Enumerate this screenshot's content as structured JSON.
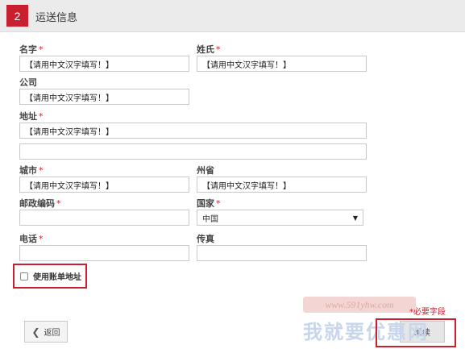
{
  "header": {
    "step": "2",
    "title": "运送信息"
  },
  "form": {
    "first_name": {
      "label": "名字",
      "value": "【请用中文汉字填写！】"
    },
    "last_name": {
      "label": "姓氏",
      "value": "【请用中文汉字填写！】"
    },
    "company": {
      "label": "公司",
      "value": "【请用中文汉字填写！】"
    },
    "address": {
      "label": "地址",
      "value": "【请用中文汉字填写！】",
      "value2": ""
    },
    "city": {
      "label": "城市",
      "value": "【请用中文汉字填写！】"
    },
    "state": {
      "label": "州省",
      "value": "【请用中文汉字填写！】"
    },
    "zip": {
      "label": "邮政编码",
      "value": ""
    },
    "country": {
      "label": "国家",
      "value": "中国"
    },
    "phone": {
      "label": "电话",
      "value": ""
    },
    "fax": {
      "label": "传真",
      "value": ""
    },
    "required_mark": "*"
  },
  "billing": {
    "label": "使用账单地址",
    "checked": false
  },
  "footer": {
    "back_label": "返回",
    "required_note": "*必要字段",
    "continue_label": "继续"
  },
  "watermark": {
    "url": "www.591yhw.com",
    "text": "我就要优惠网"
  },
  "colors": {
    "accent": "#c8202f",
    "header_bg": "#ebebeb"
  }
}
